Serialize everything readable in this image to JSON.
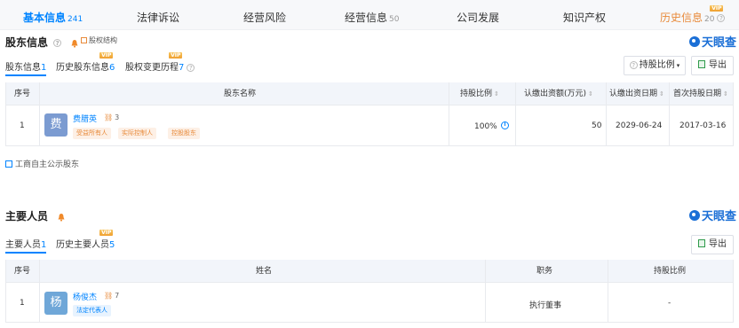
{
  "top_tabs": [
    {
      "label": "基本信息",
      "count": "241",
      "active": true
    },
    {
      "label": "法律诉讼"
    },
    {
      "label": "经营风险"
    },
    {
      "label": "经营信息",
      "count": "50"
    },
    {
      "label": "公司发展"
    },
    {
      "label": "知识产权"
    },
    {
      "label": "历史信息",
      "count": "20",
      "vip": "VIP"
    }
  ],
  "shareholders": {
    "title": "股东信息",
    "structure_link": "股权结构",
    "logo": "天眼查",
    "subtabs": [
      {
        "label": "股东信息",
        "count": "1"
      },
      {
        "label": "历史股东信息",
        "count": "6",
        "vip": "VIP"
      },
      {
        "label": "股权变更历程",
        "count": "7",
        "vip": "VIP"
      }
    ],
    "sort_button": "持股比例",
    "export_button": "导出",
    "columns": [
      "序号",
      "股东名称",
      "持股比例",
      "认缴出资额(万元)",
      "认缴出资日期",
      "首次持股日期"
    ],
    "rows": [
      {
        "index": "1",
        "avatar": "费",
        "name": "费腊英",
        "related_count": "3",
        "tags": [
          "受益所有人",
          "实际控制人",
          "控股股东"
        ],
        "ratio": "100%",
        "capital": "50",
        "capital_date": "2029-06-24",
        "first_date": "2017-03-16"
      }
    ],
    "footer_link": "工商自主公示股东"
  },
  "key_personnel": {
    "title": "主要人员",
    "logo": "天眼查",
    "subtabs": [
      {
        "label": "主要人员",
        "count": "1"
      },
      {
        "label": "历史主要人员",
        "count": "5",
        "vip": "VIP"
      }
    ],
    "export_button": "导出",
    "columns": [
      "序号",
      "姓名",
      "职务",
      "持股比例"
    ],
    "rows": [
      {
        "index": "1",
        "avatar": "杨",
        "name": "杨俊杰",
        "related_count": "7",
        "tags": [
          "法定代表人"
        ],
        "position": "执行董事",
        "ratio": "-"
      }
    ]
  }
}
